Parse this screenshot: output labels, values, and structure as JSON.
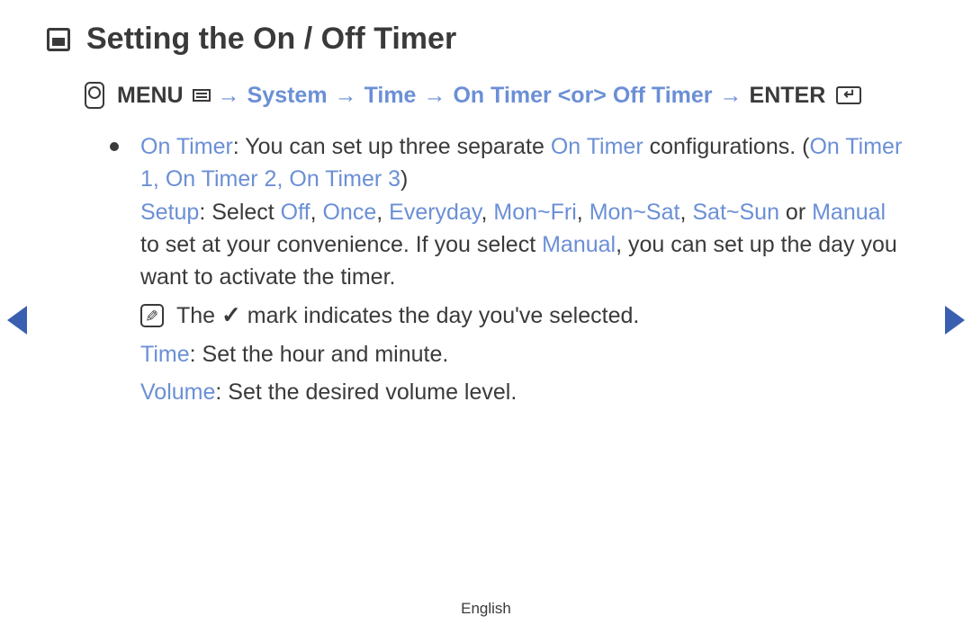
{
  "title": "Setting the On / Off Timer",
  "nav": {
    "menu": "MENU",
    "sep": "→",
    "steps": [
      "System",
      "Time",
      "On Timer <or> Off Timer"
    ],
    "enter": "ENTER"
  },
  "bullet": {
    "on_timer_label": "On Timer",
    "on_timer_text": ": You can set up three separate ",
    "on_timer_ref": "On Timer",
    "on_timer_text2": " configurations. (",
    "configs": "On Timer 1",
    "sep1": ", ",
    "config2": "On Timer 2",
    "sep2": ", ",
    "config3": "On Timer 3",
    "close": ")",
    "setup_label": "Setup",
    "setup_text1": ": Select ",
    "opt_off": "Off",
    "c1": ", ",
    "opt_once": "Once",
    "c2": ", ",
    "opt_everyday": "Everyday",
    "c3": ", ",
    "opt_monfri": "Mon~Fri",
    "c4": ", ",
    "opt_monsat": "Mon~Sat",
    "c5": ", ",
    "opt_satsun": "Sat~Sun",
    "or_text": " or ",
    "opt_manual": "Manual",
    "setup_text2": " to set at your convenience. If you select ",
    "opt_manual2": "Manual",
    "setup_text3": ", you can set up the day you want to activate the timer."
  },
  "note": {
    "pre": "The ",
    "check": "✓",
    "post": " mark indicates the day you've selected."
  },
  "time": {
    "label": "Time",
    "text": ": Set the hour and minute."
  },
  "volume": {
    "label": "Volume",
    "text": ": Set the desired volume level."
  },
  "footer": "English"
}
